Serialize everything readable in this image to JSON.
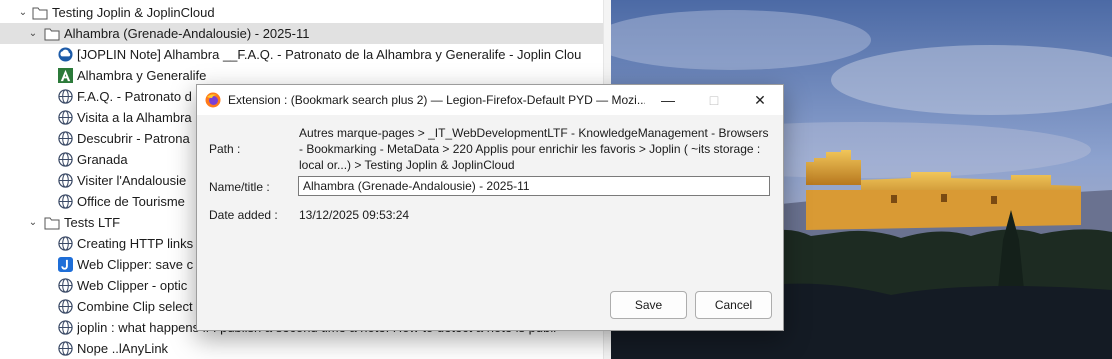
{
  "tree": {
    "rows": [
      {
        "label": "Testing Joplin & JoplinCloud",
        "kind": "folder",
        "icon": "folder-icon"
      },
      {
        "label": "Alhambra (Grenade-Andalousie) - 2025-11",
        "kind": "folder",
        "icon": "folder-icon"
      },
      {
        "label": "[JOPLIN Note] Alhambra __F.A.Q. - Patronato de la Alhambra y Generalife - Joplin Clou",
        "icon": "joplin-cloud-icon"
      },
      {
        "label": "Alhambra y Generalife",
        "icon": "alhambra-favicon-icon"
      },
      {
        "label": "F.A.Q. - Patronato d",
        "icon": "globe-icon"
      },
      {
        "label": "Visita a la Alhambra",
        "icon": "globe-icon"
      },
      {
        "label": "Descubrir - Patrona",
        "icon": "globe-icon"
      },
      {
        "label": "Granada",
        "icon": "globe-icon"
      },
      {
        "label": "Visiter l'Andalousie",
        "icon": "globe-icon"
      },
      {
        "label": "Office de Tourisme",
        "icon": "globe-icon"
      },
      {
        "label": "Tests LTF",
        "kind": "folder",
        "icon": "folder-icon"
      },
      {
        "label": "Creating HTTP links",
        "icon": "globe-icon"
      },
      {
        "label": "Web Clipper: save c",
        "icon": "joplin-icon"
      },
      {
        "label": "Web Clipper - optic",
        "icon": "globe-icon"
      },
      {
        "label": "Combine Clip select",
        "icon": "globe-icon"
      },
      {
        "label": "joplin : what happens if I publish a second time a note. How to detect a note is publi",
        "icon": "globe-icon"
      },
      {
        "label": "Nope ..lAnyLink",
        "icon": "globe-icon"
      }
    ]
  },
  "dialog": {
    "title": "Extension : (Bookmark search plus 2) — Legion-Firefox-Default PYD — Mozi...",
    "path_label": "Path :",
    "path_value": "Autres marque-pages > _IT_WebDevelopmentLTF - KnowledgeManagement - Browsers - Bookmarking - MetaData > 220 Applis pour enrichir les favoris > Joplin ( ~its storage : local or...) > Testing Joplin & JoplinCloud",
    "name_label": "Name/title :",
    "name_value": "Alhambra (Grenade-Andalousie) - 2025-11",
    "date_label": "Date added :",
    "date_value": "13/12/2025 09:53:24",
    "save_label": "Save",
    "cancel_label": "Cancel"
  }
}
